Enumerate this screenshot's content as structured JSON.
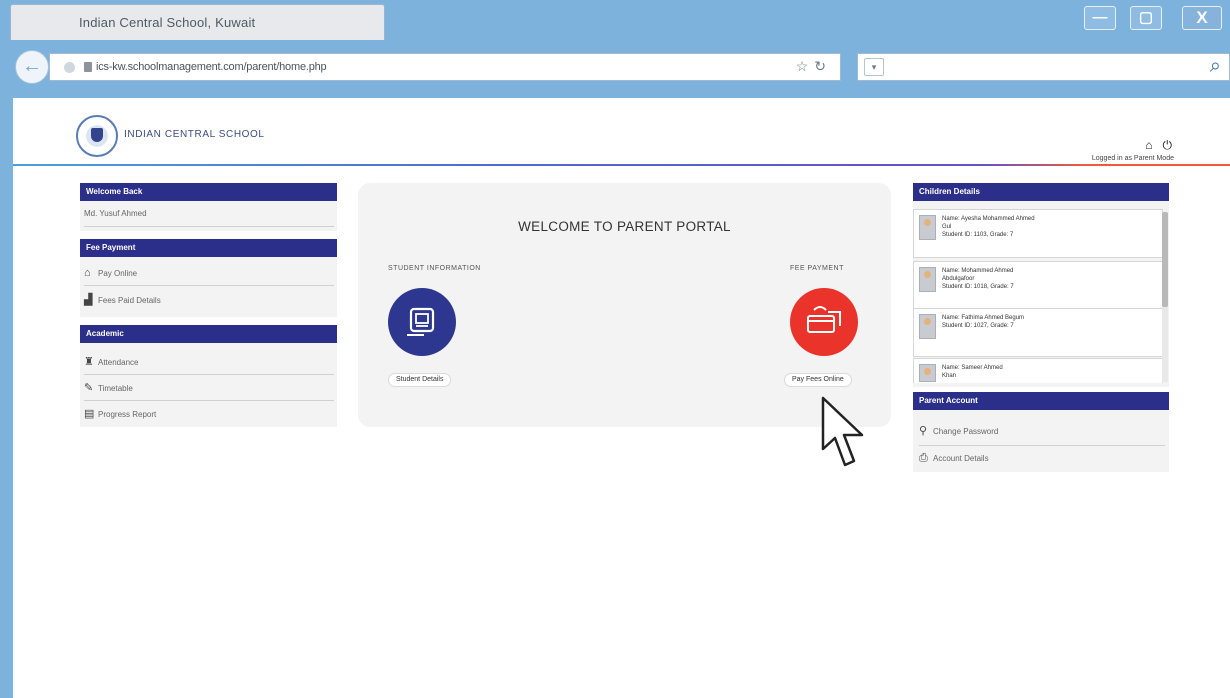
{
  "browser": {
    "tab_title": "Indian Central School, Kuwait",
    "url": "ics-kw.schoolmanagement.com/parent/home.php",
    "search_engine": "▾",
    "controls": {
      "minimize": "—",
      "maximize": "▢",
      "close": "X"
    }
  },
  "header": {
    "school_name": "INDIAN CENTRAL SCHOOL",
    "user_role": "Logged in as Parent Mode",
    "icons": [
      "home-icon",
      "power-icon"
    ]
  },
  "left_sidebar": {
    "welcome": {
      "title": "Welcome Back",
      "value": "Md. Yusuf Ahmed"
    },
    "fee_payment": {
      "title": "Fee Payment",
      "items": [
        {
          "icon": "home-icon",
          "label": "Pay Online"
        },
        {
          "icon": "chart-icon",
          "label": "Fees Paid Details"
        }
      ]
    },
    "academic": {
      "title": "Academic",
      "items": [
        {
          "icon": "person-icon",
          "label": "Attendance"
        },
        {
          "icon": "edit-icon",
          "label": "Timetable"
        },
        {
          "icon": "report-icon",
          "label": "Progress Report"
        }
      ]
    }
  },
  "main": {
    "title": "WELCOME TO PARENT PORTAL",
    "left_section": {
      "label": "STUDENT INFORMATION",
      "button": "Student Details"
    },
    "right_section": {
      "label": "FEE PAYMENT",
      "button": "Pay Fees Online"
    }
  },
  "right_sidebar": {
    "children_title": "Children Details",
    "children": [
      {
        "name": "Name: Ayesha Mohammed Ahmed",
        "sub": "Gul",
        "meta": "Student ID: 1103, Grade: 7"
      },
      {
        "name": "Name: Mohammed Ahmed",
        "sub": "Abdulgafoor",
        "meta": "Student ID: 1018, Grade: 7"
      },
      {
        "name": "Name: Fathima Ahmed Begum",
        "sub": "",
        "meta": "Student ID: 1027, Grade: 7"
      },
      {
        "name": "Name: Sameer Ahmed",
        "sub": "Khan",
        "meta": ""
      }
    ],
    "account": {
      "title": "Parent Account",
      "items": [
        {
          "icon": "key-icon",
          "label": "Change Password"
        },
        {
          "icon": "printer-icon",
          "label": "Account Details"
        }
      ]
    }
  },
  "colors": {
    "browser_blue": "#7db2dd",
    "navy": "#2c2f8a",
    "accent_red": "#e9332b",
    "card_grey": "#f3f3f3"
  }
}
